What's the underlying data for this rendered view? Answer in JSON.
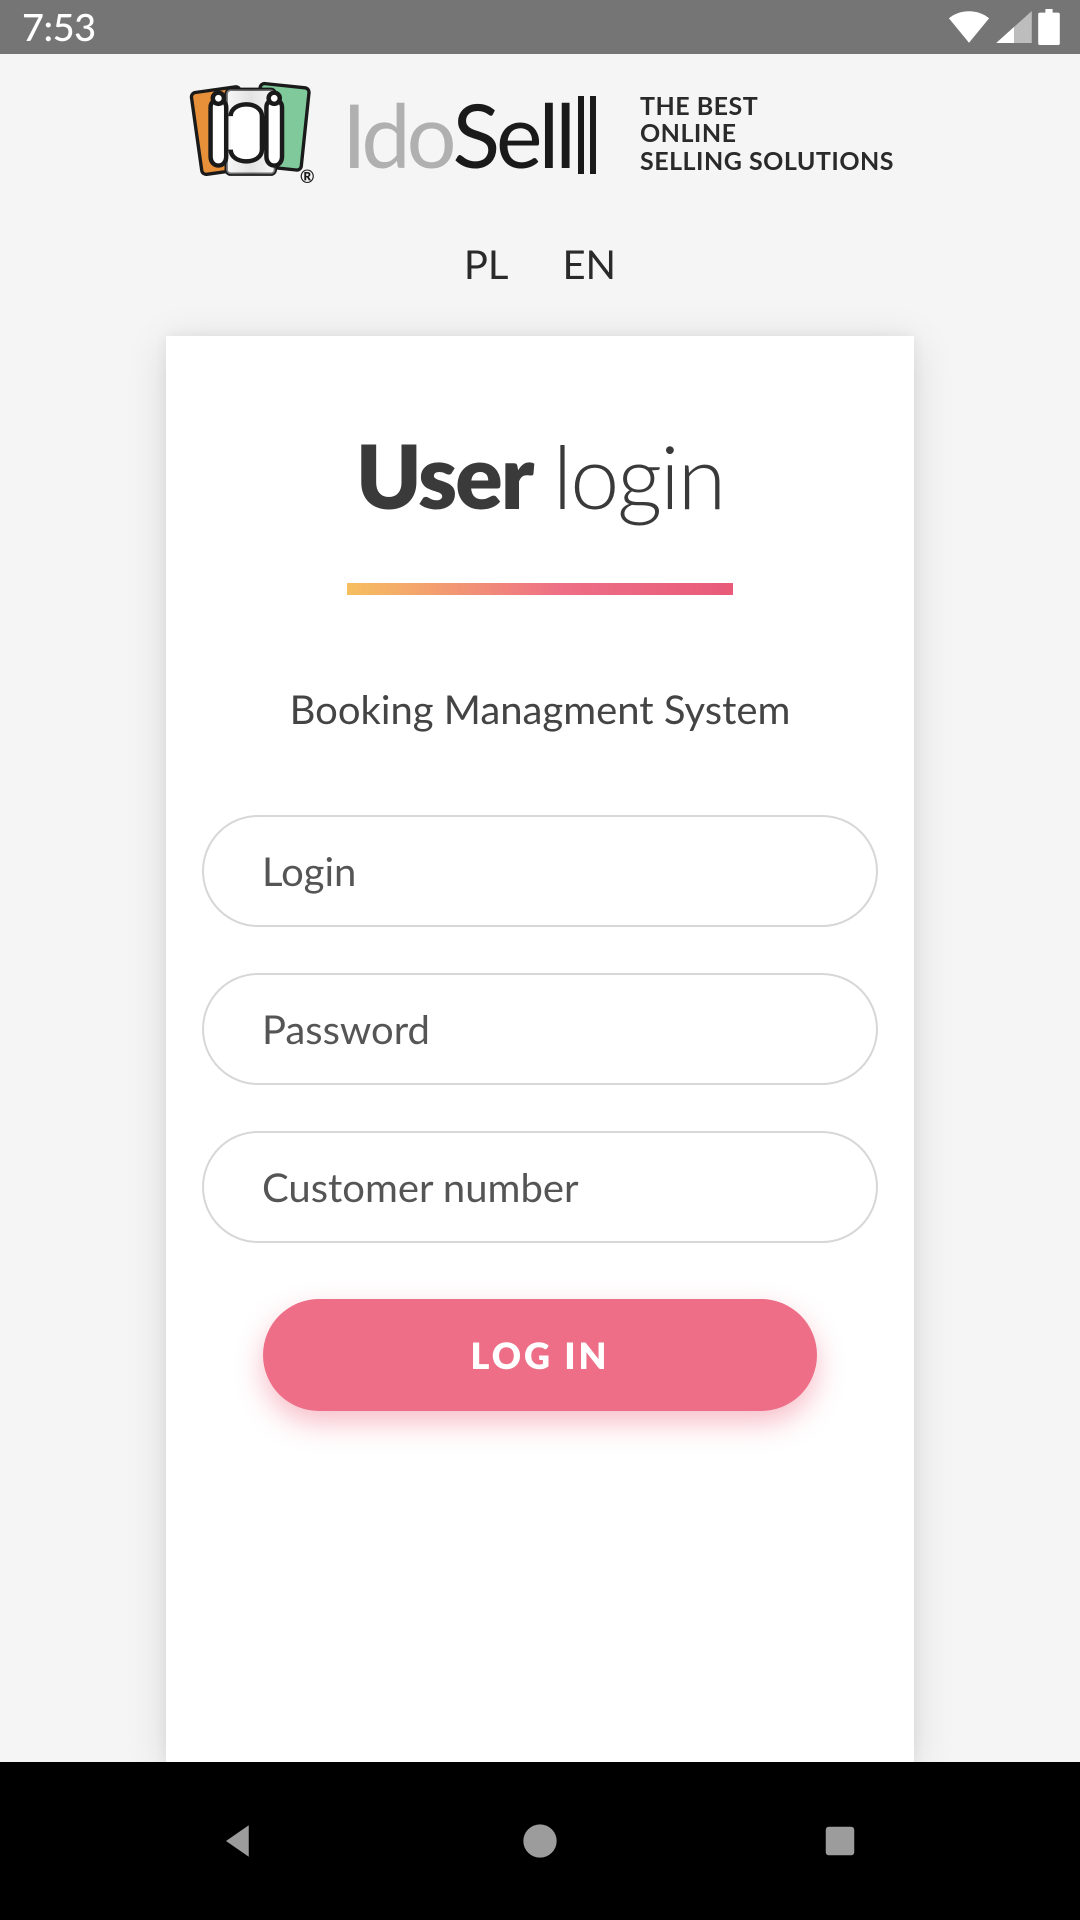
{
  "status": {
    "time": "7:53"
  },
  "brand": {
    "word_ido": "Ido",
    "word_sell": "Sell",
    "tagline_l1": "THE BEST",
    "tagline_l2": "ONLINE",
    "tagline_l3": "SELLING SOLUTIONS"
  },
  "langs": {
    "pl": "PL",
    "en": "EN"
  },
  "login": {
    "title_bold": "User",
    "title_light": "login",
    "subtitle": "Booking Managment System",
    "ph_login": "Login",
    "ph_password": "Password",
    "ph_customer": "Customer number",
    "submit": "LOG IN"
  }
}
